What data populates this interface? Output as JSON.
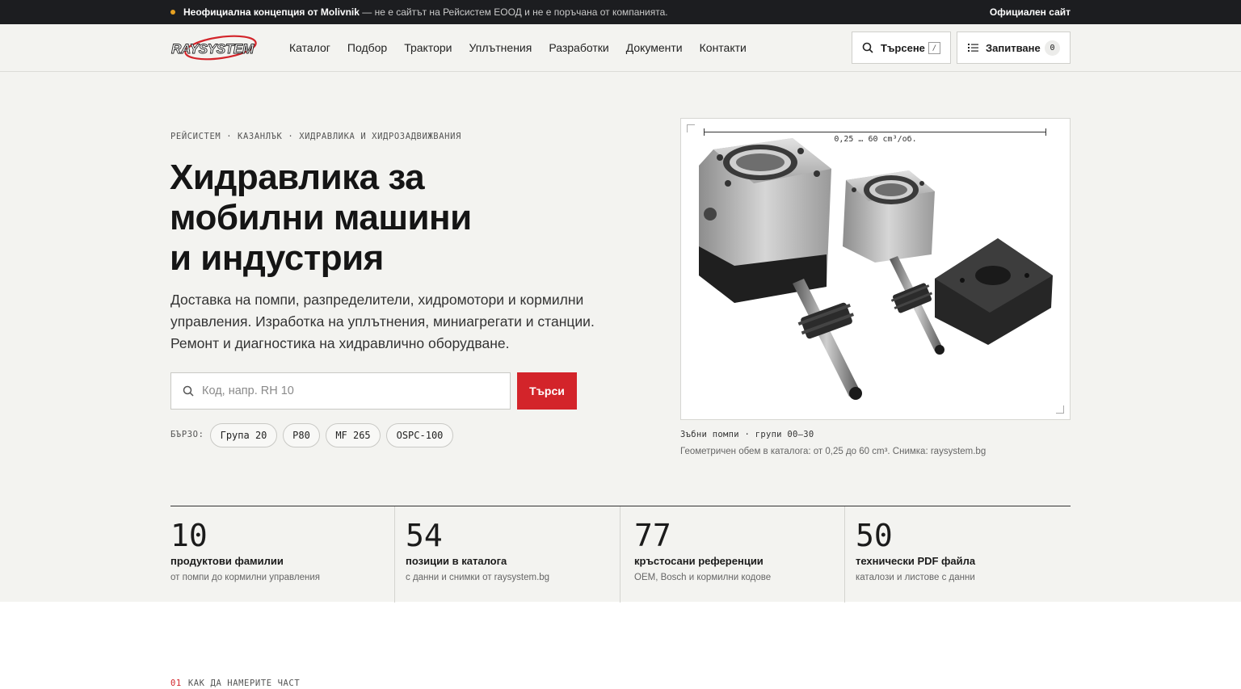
{
  "topbar": {
    "notice_bold": "Неофициална концепция от Molivnik",
    "notice_rest": " — не е сайтът на Рейсистем ЕООД и не е поръчана от компанията.",
    "official_link": "Официален сайт",
    "dot_color": "#e5a021"
  },
  "header": {
    "logo_text": "RAYSYSTEM",
    "nav": [
      "Каталог",
      "Подбор",
      "Трактори",
      "Уплътнения",
      "Разработки",
      "Документи",
      "Контакти"
    ],
    "search_label": "Търсене",
    "search_kbd": "/",
    "inquiry_label": "Запитване",
    "inquiry_count": "0"
  },
  "hero": {
    "eyebrow": "РЕЙСИСТЕМ · КАЗАНЛЪК · ХИДРАВЛИКА И ХИДРОЗАДВИЖВАНИЯ",
    "headline_1": "Хидравлика за",
    "headline_2": "мобилни машини",
    "headline_3": "и индустрия",
    "lead": "Доставка на помпи, разпределители, хидромотори и кормилни управления. Изработка на уплътнения, миниагрегати и станции. Ремонт и диагностика на хидравлично оборудване.",
    "search_placeholder": "Код, напр. RH 10",
    "search_button": "Търси",
    "quick_label": "БЪРЗО:",
    "quick_chips": [
      "Група 20",
      "P80",
      "MF 265",
      "OSPC-100"
    ],
    "accent_color": "#d3242a"
  },
  "figure": {
    "dimension_label": "0,25 … 60 cm³/об.",
    "caption_title": "Зъбни помпи · групи 00–30",
    "caption_text": "Геометричен обем в каталога: от 0,25 до 60 cm³. Снимка: raysystem.bg"
  },
  "stats": [
    {
      "num": "10",
      "label": "продуктови фамилии",
      "sub": "от помпи до кормилни управления"
    },
    {
      "num": "54",
      "label": "позиции в каталога",
      "sub": "с данни и снимки от raysystem.bg"
    },
    {
      "num": "77",
      "label": "кръстосани референции",
      "sub": "OEM, Bosch и кормилни кодове"
    },
    {
      "num": "50",
      "label": "технически PDF файла",
      "sub": "каталози и листове с данни"
    }
  ],
  "section": {
    "number": "01",
    "title": "КАК ДА НАМЕРИТЕ ЧАСТ"
  }
}
